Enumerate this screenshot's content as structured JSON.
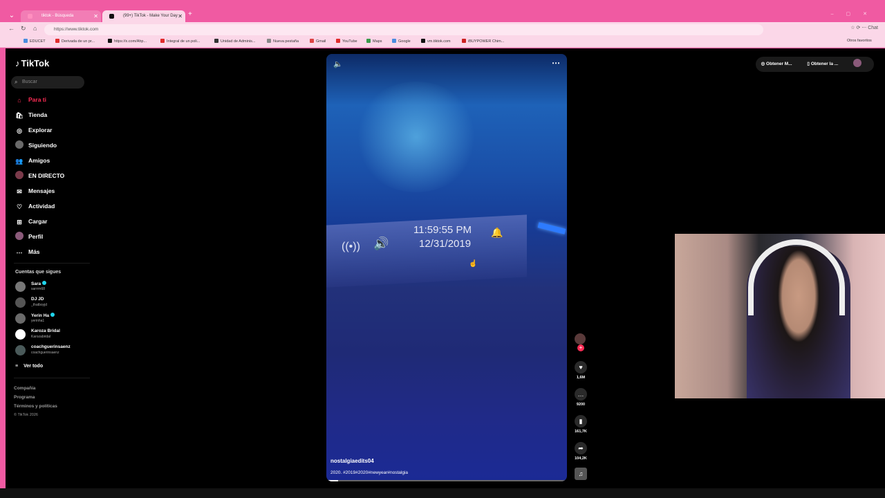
{
  "browser": {
    "tabs": [
      {
        "title": "tiktok - Búsqueda",
        "active": false
      },
      {
        "title": "(99+) TikTok - Make Your Day",
        "active": true
      }
    ],
    "url": "https://www.tiktok.com",
    "bookmarks": [
      "EDUCET",
      "Derivada de un pr...",
      "https://x.com/Ahp...",
      "Integral de un poli...",
      "Unidad de Adminis...",
      "Nueva pestaña",
      "Gmail",
      "YouTube",
      "Maps",
      "Google",
      "vm.tiktok.com",
      "iBUYPOWER Chim..."
    ],
    "other_bookmarks": "Otros favoritos",
    "chat_label": "Chat"
  },
  "sidebar": {
    "logo": "TikTok",
    "search_placeholder": "Buscar",
    "menu": [
      {
        "label": "Para ti",
        "icon": "home-icon",
        "active": true
      },
      {
        "label": "Tienda",
        "icon": "shop-icon"
      },
      {
        "label": "Explorar",
        "icon": "compass-icon"
      },
      {
        "label": "Siguiendo",
        "icon": "following-icon"
      },
      {
        "label": "Amigos",
        "icon": "friends-icon"
      },
      {
        "label": "EN DIRECTO",
        "icon": "live-icon"
      },
      {
        "label": "Mensajes",
        "icon": "message-icon"
      },
      {
        "label": "Actividad",
        "icon": "activity-icon"
      },
      {
        "label": "Cargar",
        "icon": "upload-icon"
      },
      {
        "label": "Perfil",
        "icon": "profile-icon"
      },
      {
        "label": "Más",
        "icon": "more-icon"
      }
    ],
    "following_title": "Cuentas que sigues",
    "following": [
      {
        "name": "Sara",
        "user": "sarrrm68",
        "verified": true
      },
      {
        "name": "DJ JD",
        "user": "_thatboyjd",
        "verified": false
      },
      {
        "name": "Yerin Ha",
        "user": "yerinha1",
        "verified": true
      },
      {
        "name": "Karoza Bridal",
        "user": "Karozabridal",
        "verified": false
      },
      {
        "name": "coachguerinsaenz",
        "user": "coachguerinsaenz",
        "verified": false
      }
    ],
    "see_all": "Ver todo",
    "footer": [
      "Compañía",
      "Programa",
      "Términos y políticas"
    ],
    "copyright": "© TikTok 2026"
  },
  "video": {
    "clock_time": "11:59:55 PM",
    "clock_date": "12/31/2019",
    "author": "nostalgiaedits04",
    "caption": "2020. #2019#2020#newyear#nostalgia",
    "progress": 0.05
  },
  "actions": {
    "likes": "1,6M",
    "comments": "9200",
    "saves": "161,7K",
    "shares": "104,2K"
  },
  "topbar": {
    "get_app": "Obtener M...",
    "get_desktop": "Obtener la ..."
  },
  "colors": {
    "accent": "#fe2c55",
    "browser": "#f05aa2"
  }
}
